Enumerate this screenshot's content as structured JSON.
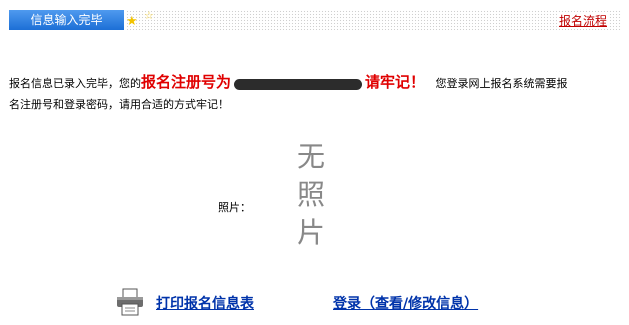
{
  "header": {
    "tab_label": "信息输入完毕",
    "flow_link": "报名流程"
  },
  "message": {
    "part1": "报名信息已录入完毕，您的",
    "reg_label": "报名注册号为",
    "remember": "请牢记！",
    "part2": "您登录网上报名系统需要报",
    "part3": "名注册号和登录密码，请用合适的方式牢记！"
  },
  "photo": {
    "label": "照片：",
    "placeholder_chars": [
      "无",
      "照",
      "片"
    ]
  },
  "actions": {
    "print_label": "打印报名信息表",
    "login_label": "登录（查看/修改信息）"
  }
}
